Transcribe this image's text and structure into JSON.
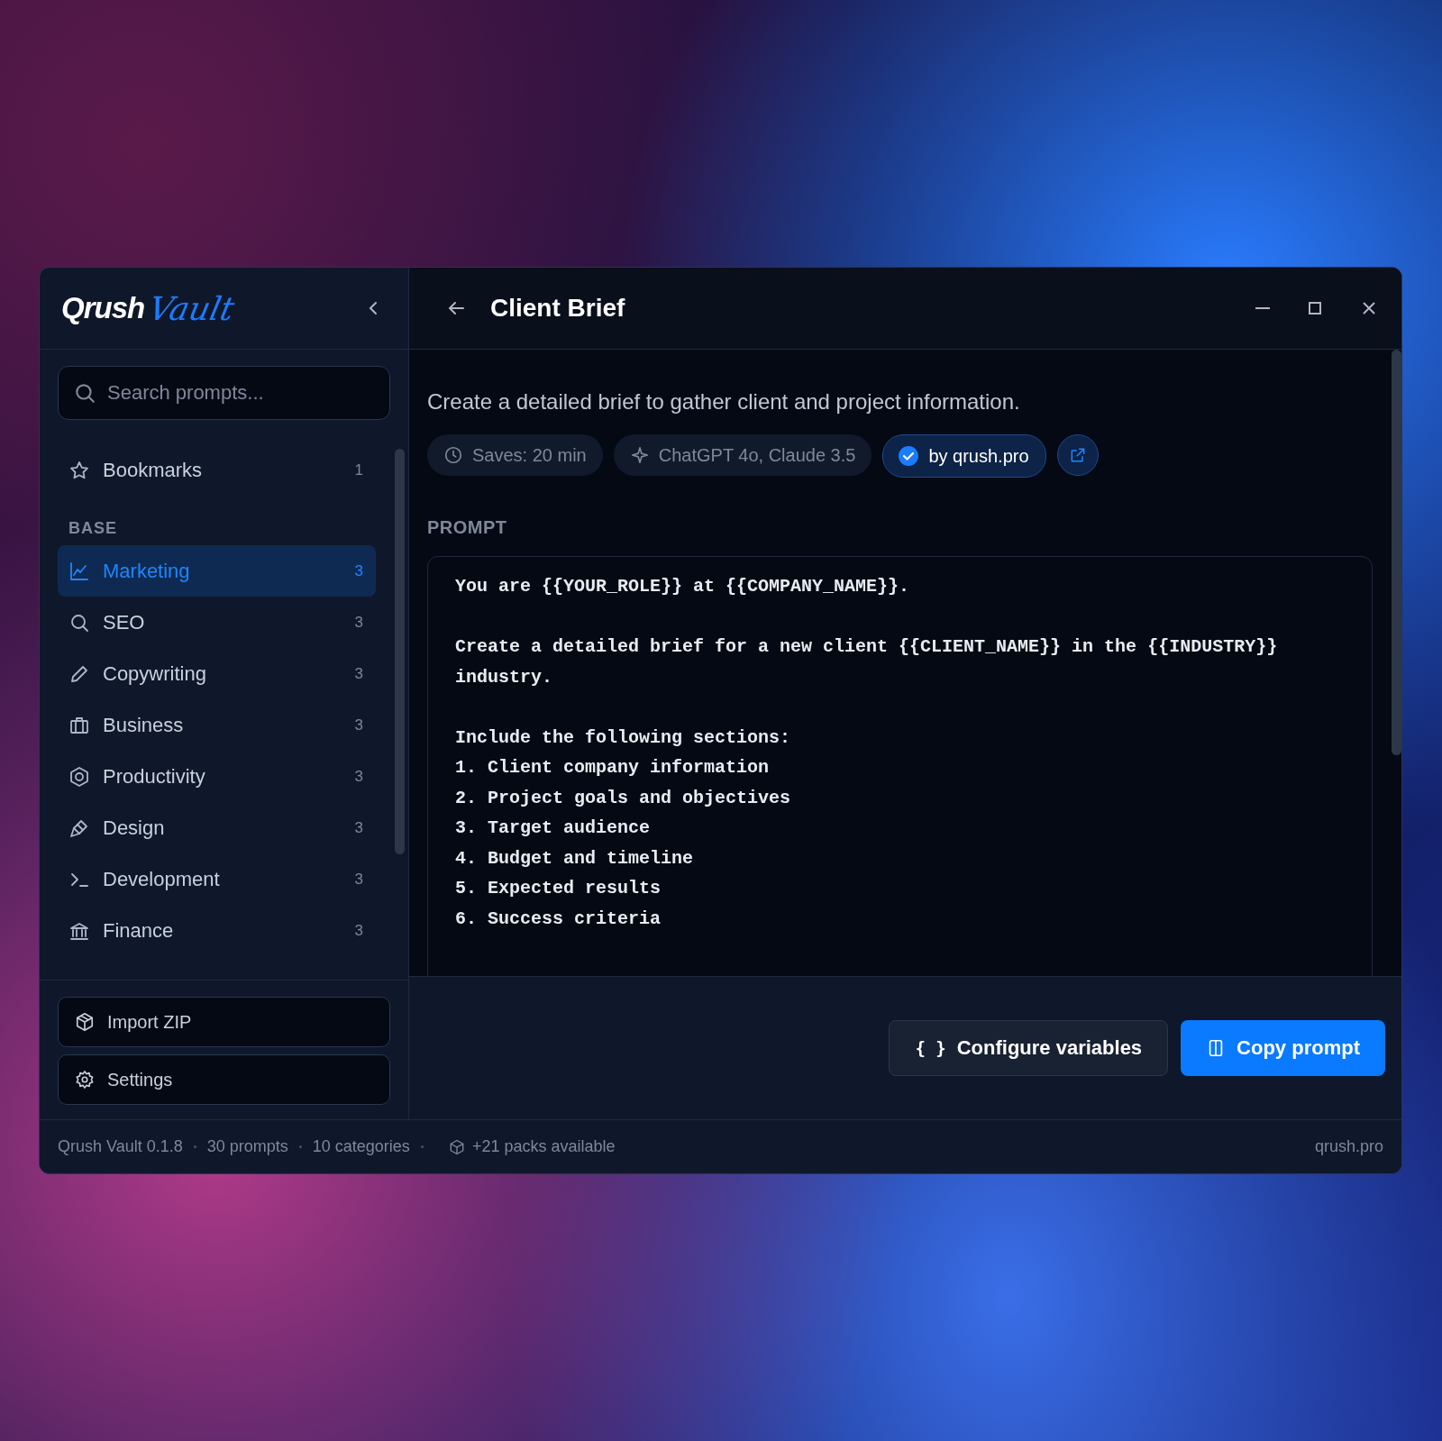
{
  "window": {
    "title": "Client Brief"
  },
  "logo": {
    "wordmark": "Qrush",
    "script": "Vault"
  },
  "sidebar": {
    "search": {
      "placeholder": "Search prompts..."
    },
    "bookmarks": {
      "label": "Bookmarks",
      "count": "1",
      "selected": false
    },
    "section_title": "BASE",
    "items": [
      {
        "label": "Marketing",
        "count": "3",
        "selected": true
      },
      {
        "label": "SEO",
        "count": "3",
        "selected": false
      },
      {
        "label": "Copywriting",
        "count": "3",
        "selected": false
      },
      {
        "label": "Business",
        "count": "3",
        "selected": false
      },
      {
        "label": "Productivity",
        "count": "3",
        "selected": false
      },
      {
        "label": "Design",
        "count": "3",
        "selected": false
      },
      {
        "label": "Development",
        "count": "3",
        "selected": false
      },
      {
        "label": "Finance",
        "count": "3",
        "selected": false
      }
    ],
    "buttons": [
      {
        "label": "Import ZIP"
      },
      {
        "label": "Settings"
      }
    ]
  },
  "description": "Create a detailed brief to gather client and project information.",
  "chips": [
    {
      "kind": "time",
      "label": "Saves: 20 min"
    },
    {
      "kind": "models",
      "label": "ChatGPT 4o, Claude 3.5"
    },
    {
      "kind": "author",
      "label": "by qrush.pro"
    }
  ],
  "prompt": {
    "heading": "PROMPT",
    "text": "You are {{YOUR_ROLE}} at {{COMPANY_NAME}}.\n\nCreate a detailed brief for a new client {{CLIENT_NAME}} in the {{INDUSTRY}}\nindustry.\n\nInclude the following sections:\n1. Client company information\n2. Project goals and objectives\n3. Target audience\n4. Budget and timeline\n5. Expected results\n6. Success criteria"
  },
  "actions": [
    {
      "kind": "secondary",
      "icon_text": "{ }",
      "label": "Configure variables"
    },
    {
      "kind": "primary",
      "label": "Copy prompt"
    }
  ],
  "status_bar": {
    "items": [
      "Qrush Vault 0.1.8",
      "30 prompts",
      "10 categories"
    ],
    "packs": "+21 packs available",
    "link": "qrush.pro"
  }
}
